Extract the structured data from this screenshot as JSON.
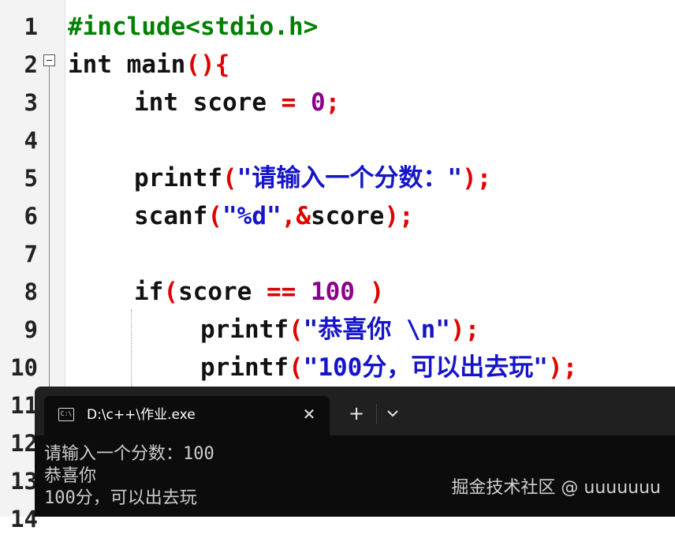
{
  "editor": {
    "line_numbers": [
      "1",
      "2",
      "3",
      "4",
      "5",
      "6",
      "7",
      "8",
      "9",
      "10",
      "11",
      "12",
      "13",
      "14"
    ],
    "code": {
      "l1": [
        "#include<stdio.h>"
      ],
      "l2": [
        "int",
        " main",
        "(){"
      ],
      "l3": [
        "int",
        " score ",
        "= ",
        "0",
        ";"
      ],
      "l5": [
        "printf",
        "(",
        "\"请输入一个分数：\"",
        ");"
      ],
      "l6": [
        "scanf",
        "(",
        "\"%d\"",
        ",&",
        "score",
        ");"
      ],
      "l8": [
        "if",
        "(",
        "score ",
        "== ",
        "100",
        " )"
      ],
      "l9": [
        "printf",
        "(",
        "\"恭喜你 \\n\"",
        ");"
      ],
      "l10": [
        "printf",
        "(",
        "\"100分，可以出去玩\"",
        ");"
      ]
    }
  },
  "console": {
    "tab_title": "D:\\c++\\作业.exe",
    "tab_icon": "C:\\",
    "close_glyph": "✕",
    "new_tab_glyph": "+",
    "output_lines": [
      "请输入一个分数：100",
      "恭喜你",
      "100分，可以出去玩"
    ]
  },
  "watermark": "掘金技术社区 @ uuuuuuu",
  "colors": {
    "preprocessor": "#008000",
    "operator": "#e00000",
    "number": "#8b008b",
    "string": "#1515c8",
    "console_bg": "#0c0c0c"
  }
}
